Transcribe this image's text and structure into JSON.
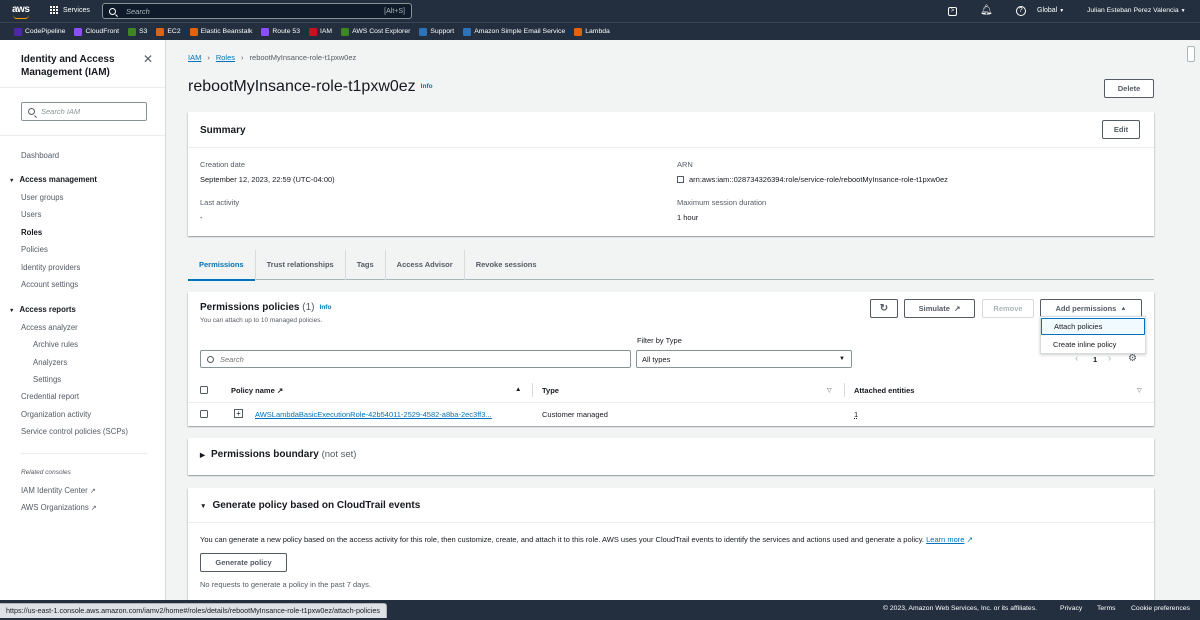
{
  "top": {
    "logo": "aws",
    "services": "Services",
    "search_placeholder": "Search",
    "search_shortcut": "[Alt+S]",
    "region": "Global",
    "user": "Julian Esteban Perez Valencia"
  },
  "favorites": [
    {
      "label": "CodePipeline",
      "color": "#4d27a8"
    },
    {
      "label": "CloudFront",
      "color": "#8c4fff"
    },
    {
      "label": "S3",
      "color": "#3f8624"
    },
    {
      "label": "EC2",
      "color": "#d86613"
    },
    {
      "label": "Elastic Beanstalk",
      "color": "#d86613"
    },
    {
      "label": "Route 53",
      "color": "#8c4fff"
    },
    {
      "label": "IAM",
      "color": "#c7131f"
    },
    {
      "label": "AWS Cost Explorer",
      "color": "#3f8624"
    },
    {
      "label": "Support",
      "color": "#2e73b8"
    },
    {
      "label": "Amazon Simple Email Service",
      "color": "#2e73b8"
    },
    {
      "label": "Lambda",
      "color": "#d86613"
    }
  ],
  "sidebar": {
    "title": "Identity and Access Management (IAM)",
    "search_placeholder": "Search IAM",
    "dashboard": "Dashboard",
    "access_management": "Access management",
    "user_groups": "User groups",
    "users": "Users",
    "roles": "Roles",
    "policies": "Policies",
    "identity_providers": "Identity providers",
    "account_settings": "Account settings",
    "access_reports": "Access reports",
    "access_analyzer": "Access analyzer",
    "archive_rules": "Archive rules",
    "analyzers": "Analyzers",
    "settings": "Settings",
    "credential_report": "Credential report",
    "organization_activity": "Organization activity",
    "scps": "Service control policies (SCPs)",
    "related_consoles": "Related consoles",
    "identity_center": "IAM Identity Center",
    "organizations": "AWS Organizations"
  },
  "breadcrumb": {
    "iam": "IAM",
    "roles": "Roles",
    "current": "rebootMyInsance-role-t1pxw0ez"
  },
  "page": {
    "title": "rebootMyInsance-role-t1pxw0ez",
    "info": "Info",
    "delete": "Delete"
  },
  "summary": {
    "heading": "Summary",
    "edit": "Edit",
    "creation_date_label": "Creation date",
    "creation_date": "September 12, 2023, 22:59 (UTC-04:00)",
    "arn_label": "ARN",
    "arn": "arn:aws:iam::028734326394:role/service-role/rebootMyInsance-role-t1pxw0ez",
    "last_activity_label": "Last activity",
    "last_activity": "-",
    "max_session_label": "Maximum session duration",
    "max_session": "1 hour"
  },
  "tabs": [
    "Permissions",
    "Trust relationships",
    "Tags",
    "Access Advisor",
    "Revoke sessions"
  ],
  "permissions": {
    "heading": "Permissions policies",
    "count": "(1)",
    "info": "Info",
    "sub": "You can attach up to 10 managed policies.",
    "simulate": "Simulate",
    "remove": "Remove",
    "add": "Add permissions",
    "dropdown": [
      "Attach policies",
      "Create inline policy"
    ],
    "search_placeholder": "Search",
    "filter_label": "Filter by Type",
    "filter_value": "All types",
    "page": "1",
    "columns": [
      "Policy name",
      "Type",
      "Attached entities"
    ],
    "rows": [
      {
        "name": "AWSLambdaBasicExecutionRole-42b54011-2529-4582-a8ba-2ec3ff3...",
        "type": "Customer managed",
        "entities": "1"
      }
    ]
  },
  "boundary": {
    "heading": "Permissions boundary",
    "sub": "(not set)"
  },
  "generate": {
    "heading": "Generate policy based on CloudTrail events",
    "desc": "You can generate a new policy based on the access activity for this role, then customize, create, and attach it to this role. AWS uses your CloudTrail events to identify the services and actions used and generate a policy.",
    "learn_more": "Learn more",
    "button": "Generate policy",
    "note": "No requests to generate a policy in the past 7 days."
  },
  "footer": {
    "url": "https://us-east-1.console.aws.amazon.com/iamv2/home#/roles/details/rebootMyInsance-role-t1pxw0ez/attach-policies",
    "copyright": "© 2023, Amazon Web Services, Inc. or its affiliates.",
    "privacy": "Privacy",
    "terms": "Terms",
    "cookies": "Cookie preferences"
  }
}
